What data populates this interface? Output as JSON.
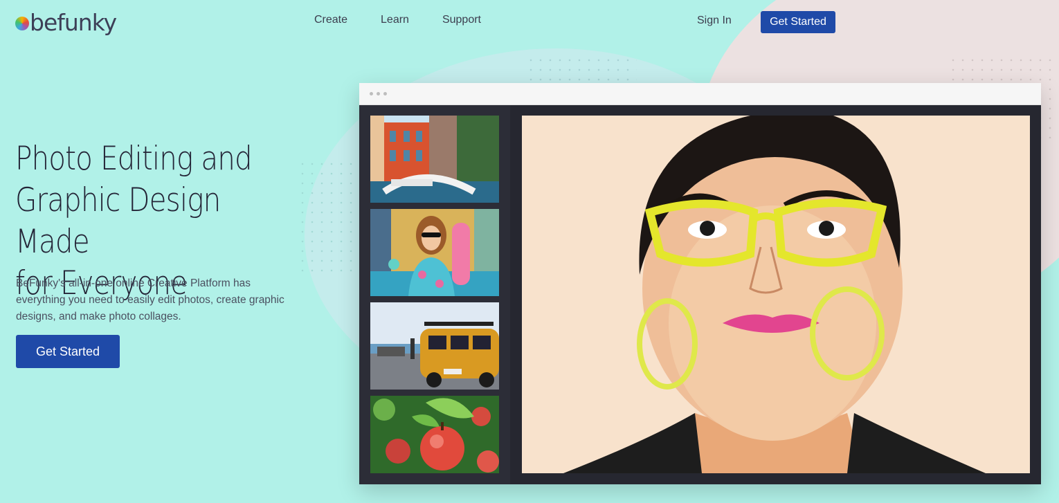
{
  "brand": {
    "logo_text": "befunky"
  },
  "nav": {
    "items": [
      "Create",
      "Learn",
      "Support"
    ],
    "sign_in": "Sign In",
    "get_started": "Get Started"
  },
  "hero": {
    "title_lines": [
      "Photo Editing and",
      "Graphic Design Made",
      "for Everyone"
    ],
    "description": "BeFunky's all-in-one online Creative Platform has everything you need to easily edit photos, create graphic designs, and make photo collages.",
    "cta": "Get Started"
  },
  "colors": {
    "background": "#b1f1e8",
    "primary": "#1f4aa8",
    "editor_dark": "#262730"
  },
  "editor": {
    "thumbnails": [
      "venice-canal-photo",
      "woman-skateboard-photo",
      "vintage-van-beach-photo",
      "apple-tree-photo"
    ],
    "main_image": "woman-yellow-glasses-cartoonized-photo"
  }
}
